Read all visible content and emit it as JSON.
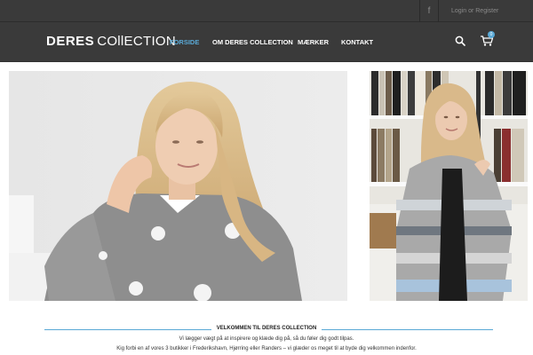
{
  "topbar": {
    "facebook_icon": "facebook-icon",
    "login_label": "Login or Register"
  },
  "header": {
    "logo_bold": "DERES",
    "logo_light": "COllECTION",
    "nav": [
      {
        "label": "FORSIDE",
        "active": true
      },
      {
        "label": "OM DERES COLLECTION",
        "active": false
      },
      {
        "label": "MÆRKER",
        "active": false
      },
      {
        "label": "KONTAKT",
        "active": false
      }
    ],
    "cart_count": "0",
    "icons": [
      "search-icon",
      "shopping-cart-icon"
    ]
  },
  "welcome": {
    "heading": "VELKOMMEN TIL DERES COLLECTION",
    "line1": "Vi lægger vægt på at inspirere og klæde dig på, så du føler dig godt tilpas.",
    "line2": "Kig forbi en af vores 3 butikker i Frederikshavn, Hjørring eller Randers – vi glæder os meget til at byde dig velkommen indenfor."
  },
  "colors": {
    "header_bg": "#3a3a3a",
    "accent": "#5aa9d6",
    "text": "#333333"
  }
}
